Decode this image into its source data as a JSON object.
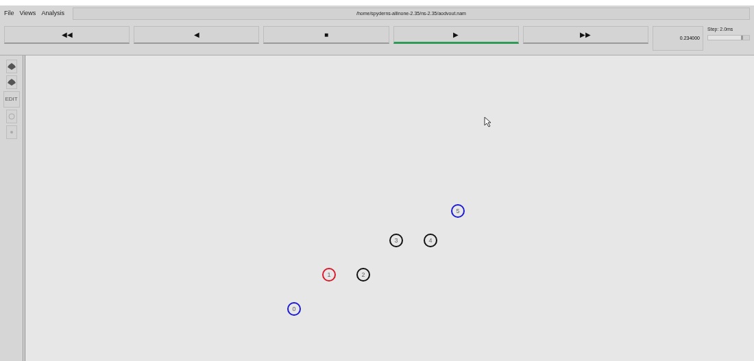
{
  "menu": [
    {
      "label": "File"
    },
    {
      "label": "Views"
    },
    {
      "label": "Analysis"
    }
  ],
  "file_path": "/home/spyderns-allinone-2.35/ns-2.35/aodvout.nam",
  "controls": [
    {
      "label": "◀◀",
      "selected": false
    },
    {
      "label": "◀",
      "selected": false
    },
    {
      "label": "■",
      "selected": false
    },
    {
      "label": "▶",
      "selected": true
    },
    {
      "label": "▶▶",
      "selected": false
    }
  ],
  "time": "0.234000",
  "step": {
    "label": "Step: 2.0ms",
    "level": 0.85
  },
  "tools": [
    {
      "kind": "icon"
    },
    {
      "kind": "icon"
    },
    {
      "kind": "text",
      "label": "EDIT"
    },
    {
      "kind": "circle"
    },
    {
      "kind": "dot"
    }
  ],
  "nodes": [
    {
      "label": "0",
      "color": "#1a1ad0"
    },
    {
      "label": "1",
      "color": "#d81a2a"
    },
    {
      "label": "2",
      "color": "#111111"
    },
    {
      "label": "3",
      "color": "#111111"
    },
    {
      "label": "4",
      "color": "#111111"
    },
    {
      "label": "5",
      "color": "#1a1ad0"
    }
  ]
}
